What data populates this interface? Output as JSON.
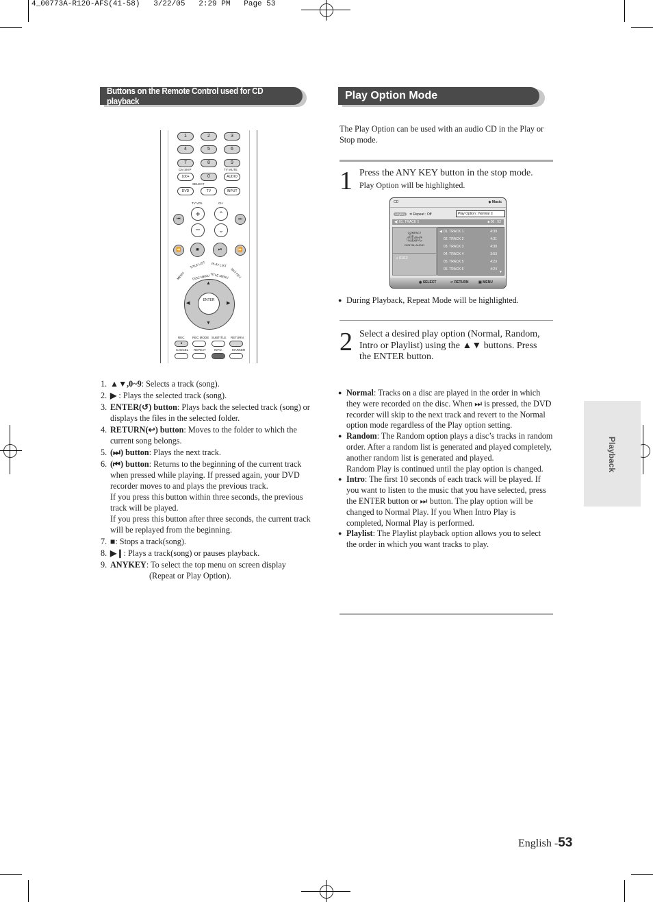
{
  "slug": "4_00773A-R120-AFS(41-58)   3/22/05   2:29 PM   Page 53",
  "left": {
    "header": "Buttons on the Remote Control used for CD playback",
    "remote": {
      "numbers": [
        "1",
        "2",
        "3",
        "4",
        "5",
        "6",
        "7",
        "8",
        "9",
        "0"
      ],
      "cm_skip": "CM SKIP",
      "k100": "100+",
      "tv_mute": "TV MUTE",
      "audio": "AUDIO",
      "select": "SELECT",
      "dvd": "DVD",
      "tv": "TV",
      "input": "INPUT",
      "tv_vol": "TV VOL",
      "ch": "CH",
      "title_list": "TITLE LIST",
      "play_list": "PLAY LIST",
      "menu": "MENU",
      "any_key": "ANY KEY",
      "disc_menu": "DISC MENU",
      "title_menu": "TITLE MENU",
      "enter": "ENTER",
      "rec": "REC",
      "rec_mode": "REC MODE",
      "subtitle": "SUBTITLE",
      "return": "RETURN",
      "cancel": "CANCEL",
      "repeat": "REPEAT",
      "info": "INFO.",
      "marker": "MARKER"
    },
    "items": [
      {
        "num": "1.",
        "bold": "▲▼,0~9",
        "text": ": Selects a track (song)."
      },
      {
        "num": "2.",
        "bold": "▶",
        "text": " : Plays the selected track (song)."
      },
      {
        "num": "3.",
        "bold": "ENTER(↺) button",
        "text": ": Plays back the selected track (song) or displays the files in the selected folder."
      },
      {
        "num": "4.",
        "bold": "RETURN(↩) button",
        "text": ": Moves to the folder to which the current song belongs."
      },
      {
        "num": "5.",
        "bold": "(⏭) button",
        "text": ": Plays the next track."
      },
      {
        "num": "6.",
        "bold": "(⏮) button",
        "text": ": Returns to the beginning of the current track when pressed while playing. If pressed again, your DVD recorder moves to and plays the previous track.",
        "extra": [
          "If you press this button within three seconds, the previous track will be played.",
          "If you press this button after three seconds, the current track will be replayed from the beginning."
        ]
      },
      {
        "num": "7.",
        "bold": "■",
        "text": ": Stops a track(song)."
      },
      {
        "num": "8.",
        "bold": "▶❙",
        "text": ": Plays a track(song) or pauses playback."
      },
      {
        "num": "9.",
        "bold": "ANYKEY",
        "text": ": To select the top menu on screen display",
        "extra2": "(Repeat or Play Option)."
      }
    ]
  },
  "right": {
    "header": "Play Option Mode",
    "intro": "The Play Option can be used with an audio CD in the Play or Stop mode.",
    "step1": {
      "num": "1",
      "title": "Press the ANY KEY button in the stop mode.",
      "sub": "Play Option will be highlighted."
    },
    "osd": {
      "source": "CD",
      "mode": "Music",
      "anykey": "Anykey",
      "repeat": "Repeat : Off",
      "play_option": "Play Option : Normal",
      "now_playing": "01. TRACK 1",
      "time": "00 : 52",
      "disc_logo": "disc",
      "disc_compact": "COMPACT",
      "disc_digital": "DIGITAL AUDIO",
      "track_count": "01/12",
      "tracks": [
        {
          "name": "01. TRACK 1",
          "time": "4:39"
        },
        {
          "name": "02. TRACK 2",
          "time": "4:31"
        },
        {
          "name": "03. TRACK 3",
          "time": "4:30"
        },
        {
          "name": "04. TRACK 4",
          "time": "3:53"
        },
        {
          "name": "05. TRACK 5",
          "time": "4:23"
        },
        {
          "name": "06. TRACK 6",
          "time": "4:24"
        }
      ],
      "footer": {
        "select": "SELECT",
        "return": "RETURN",
        "menu": "MENU"
      }
    },
    "note": "During Playback, Repeat Mode will be highlighted.",
    "step2": {
      "num": "2",
      "title": "Select a desired play option (Normal, Random, Intro or Playlist) using the ▲▼ buttons. Press the ENTER button."
    },
    "options": [
      {
        "name": "Normal",
        "text": ": Tracks on a disc are played in the order in which they were recorded on the disc. When ⏭ is pressed, the DVD recorder will skip to the next track and revert to the Normal option mode regardless of the Play option setting."
      },
      {
        "name": "Random",
        "text": ": The Random option plays a disc’s tracks in random order. After a random list is generated and played completely, another random list is generated and played.",
        "extra": "Random Play is continued until the play option is changed."
      },
      {
        "name": "Intro",
        "text": ": The first 10 seconds of each track will be played. If you want to listen to the music that you have selected, press the ENTER button or ⏭ button. The play option will be changed to Normal Play. If you When Intro Play is completed, Normal Play is performed."
      },
      {
        "name": "Playlist",
        "text": ": The Playlist playback option allows you to select the order in which you want tracks to play."
      }
    ]
  },
  "side_tab": "Playback",
  "footer": {
    "lang": "English -",
    "page": "53"
  }
}
